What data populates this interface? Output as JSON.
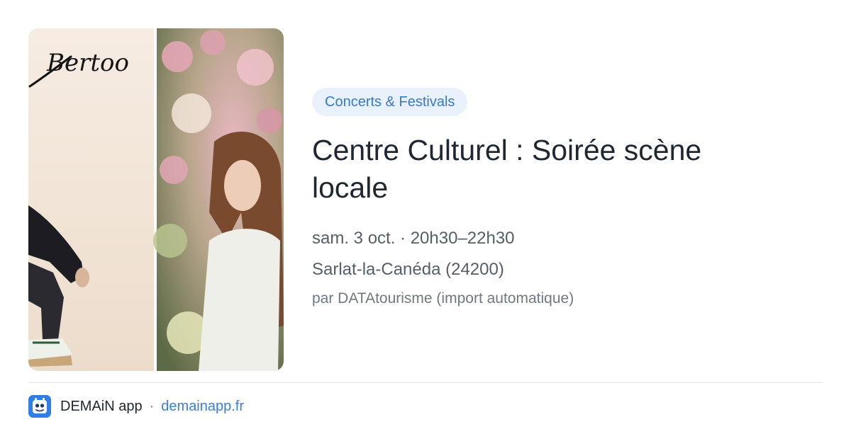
{
  "event": {
    "image": {
      "artist_logo": "Bertoo"
    },
    "category": "Concerts & Festivals",
    "title": "Centre Culturel : Soirée scène locale",
    "datetime": "sam. 3 oct. · 20h30–22h30",
    "location": "Sarlat-la-Canéda (24200)",
    "source": "par DATAtourisme (import automatique)"
  },
  "footer": {
    "app_icon": "app-logo-icon",
    "app_name": "DEMAiN app",
    "separator": "·",
    "domain": "demainapp.fr"
  },
  "colors": {
    "chip_background": "#e9f1fb",
    "chip_text": "#3879cc",
    "title": "#1e2732",
    "meta": "#555e69",
    "link": "#3b7dd8",
    "app_icon": "#2f7fe6"
  }
}
